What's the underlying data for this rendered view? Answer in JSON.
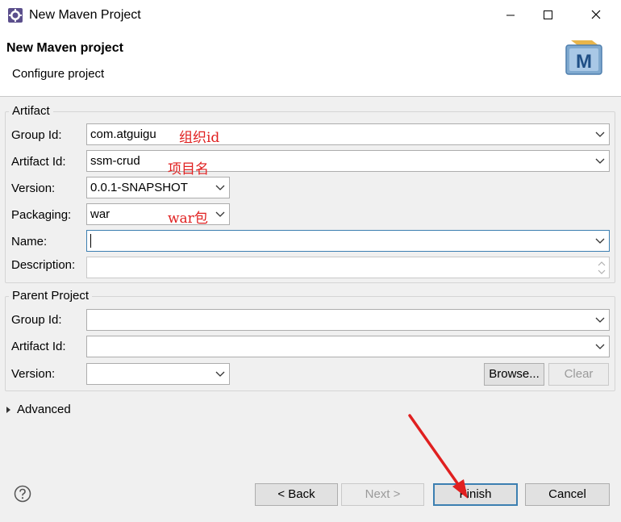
{
  "window": {
    "title": "New Maven Project"
  },
  "header": {
    "title": "New Maven project",
    "subtitle": "Configure project",
    "logo_letter": "M"
  },
  "artifact": {
    "group_title": "Artifact",
    "group_id_label": "Group Id:",
    "group_id_value": "com.atguigu",
    "artifact_id_label": "Artifact Id:",
    "artifact_id_value": "ssm-crud",
    "version_label": "Version:",
    "version_value": "0.0.1-SNAPSHOT",
    "packaging_label": "Packaging:",
    "packaging_value": "war",
    "name_label": "Name:",
    "name_value": "",
    "description_label": "Description:",
    "description_value": ""
  },
  "annotations": {
    "group_id": "组织id",
    "artifact_id": "项目名",
    "packaging": "war包",
    "color": "#e02020"
  },
  "parent": {
    "group_title": "Parent Project",
    "group_id_label": "Group Id:",
    "artifact_id_label": "Artifact Id:",
    "version_label": "Version:",
    "browse_label": "Browse...",
    "clear_label": "Clear"
  },
  "advanced": {
    "label": "Advanced"
  },
  "footer": {
    "back_label": "< Back",
    "next_label": "Next >",
    "finish_label": "Finish",
    "cancel_label": "Cancel"
  },
  "colors": {
    "accent": "#3c7fb1",
    "annotation": "#e02020"
  }
}
